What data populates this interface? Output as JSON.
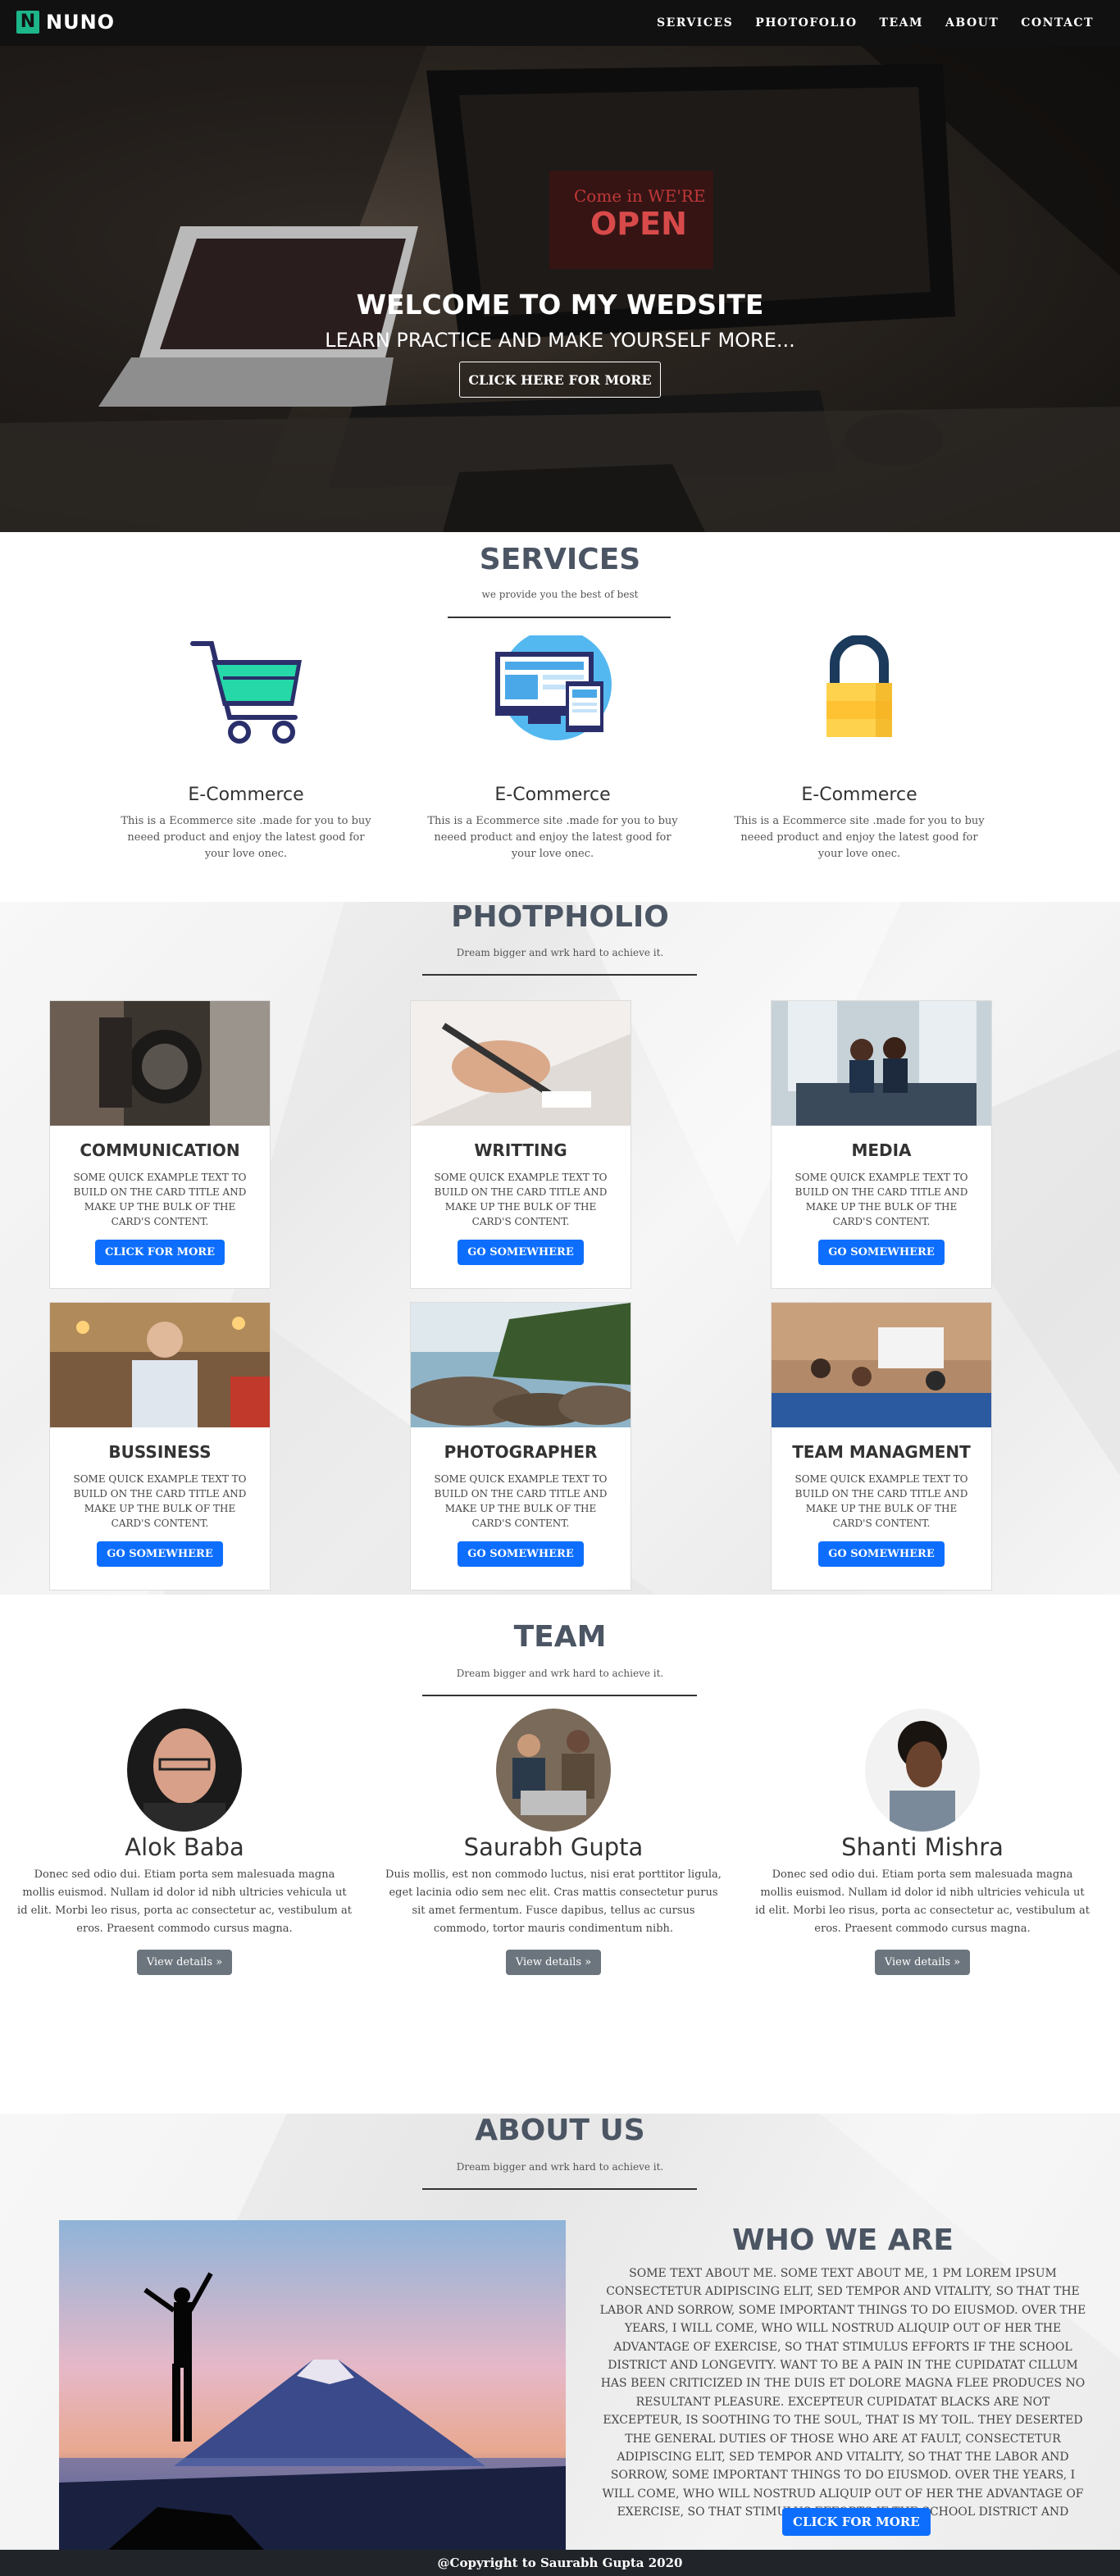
{
  "nav": {
    "brand_letter": "N",
    "brand_name": "NUNO",
    "links": [
      "SERVICES",
      "PHOTOFOLIO",
      "TEAM",
      "ABOUT",
      "CONTACT"
    ]
  },
  "hero": {
    "title": "WELCOME TO MY WEDSITE",
    "subtitle": "LEARN PRACTICE AND MAKE YOURSELF MORE...",
    "button": "CLICK HERE FOR MORE",
    "sign_top": "Come in WE'RE",
    "sign_main": "OPEN"
  },
  "services": {
    "title": "SERVICES",
    "subtitle": "we provide you the best of best",
    "items": [
      {
        "icon": "shopping-cart-icon",
        "title": "E-Commerce",
        "text": "This is a Ecommerce site .made for you to buy neeed product and enjoy the latest good for your love onec."
      },
      {
        "icon": "web-design-icon",
        "title": "E-Commerce",
        "text": "This is a Ecommerce site .made for you to buy neeed product and enjoy the latest good for your love onec."
      },
      {
        "icon": "lock-icon",
        "title": "E-Commerce",
        "text": "This is a Ecommerce site .made for you to buy neeed product and enjoy the latest good for your love onec."
      }
    ]
  },
  "portfolio": {
    "title": "PHOTPHOLIO",
    "subtitle": "Dream bigger and wrk hard to achieve it.",
    "card_text": "Some quick example text to build on the card title and make up the bulk of the card's content.",
    "cards": [
      {
        "title": "COMMUNICATION",
        "button": "CLICK FOR MORE"
      },
      {
        "title": "WRITTING",
        "button": "GO SOMEWHERE"
      },
      {
        "title": "MEDIA",
        "button": "GO SOMEWHERE"
      },
      {
        "title": "BUSSINESS",
        "button": "GO SOMEWHERE"
      },
      {
        "title": "PHOTOGRAPHER",
        "button": "GO SOMEWHERE"
      },
      {
        "title": "TEAM MANAGMENT",
        "button": "GO SOMEWHERE"
      }
    ]
  },
  "team": {
    "title": "TEAM",
    "subtitle": "Dream bigger and wrk hard to achieve it.",
    "members": [
      {
        "name": "Alok Baba",
        "text": "Donec sed odio dui. Etiam porta sem malesuada magna mollis euismod. Nullam id dolor id nibh ultricies vehicula ut id elit. Morbi leo risus, porta ac consectetur ac, vestibulum at eros. Praesent commodo cursus magna.",
        "button": "View details »"
      },
      {
        "name": "Saurabh Gupta",
        "text": "Duis mollis, est non commodo luctus, nisi erat porttitor ligula, eget lacinia odio sem nec elit. Cras mattis consectetur purus sit amet fermentum. Fusce dapibus, tellus ac cursus commodo, tortor mauris condimentum nibh.",
        "button": "View details »"
      },
      {
        "name": "Shanti Mishra",
        "text": "Donec sed odio dui. Etiam porta sem malesuada magna mollis euismod. Nullam id dolor id nibh ultricies vehicula ut id elit. Morbi leo risus, porta ac consectetur ac, vestibulum at eros. Praesent commodo cursus magna.",
        "button": "View details »"
      }
    ]
  },
  "about": {
    "title": "ABOUT US",
    "subtitle": "Dream bigger and wrk hard to achieve it.",
    "who_title": "WHO WE ARE",
    "who_text": "Some text about me. Some text about me, 1 pm Lorem ipsum consectetur adipiscing elit, sed tempor and vitality, so that the labor and sorrow, some important things to do eiusmod. Over the years, I will come, who will nostrud aliquip out of her the advantage of exercise, so that stimulus efforts if the school district and longevity. Want to be a pain in the cupidatat cillum has been criticized in the Duis et dolore magna flee produces no resultant pleasure. Excepteur cupidatat blacks are not excepteur, is soothing to the soul, that is my toil. They deserted the general duties of those who are at fault, consectetur adipiscing elit, sed tempor and vitality, so that the labor and sorrow, some important things to do eiusmod. Over the years, I will come, who will nostrud aliquip out of her the advantage of exercise, so that stimulus efforts if the school district and longevity.",
    "button": "CLICK FOR MORE"
  },
  "footer": {
    "text": "@Copyright to Saurabh Gupta 2020"
  }
}
